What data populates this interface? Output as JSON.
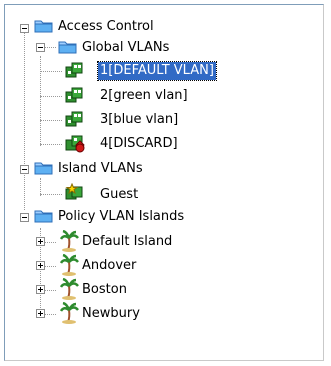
{
  "tree": {
    "access_control": {
      "label": "Access Control",
      "icon": "folder-icon"
    },
    "global_vlans": {
      "label": "Global VLANs",
      "icon": "folder-icon"
    },
    "vlans": [
      {
        "label": "1[DEFAULT VLAN]",
        "icon": "vlan-icon",
        "selected": true
      },
      {
        "label": "2[green vlan]",
        "icon": "vlan-icon"
      },
      {
        "label": "3[blue vlan]",
        "icon": "vlan-icon"
      },
      {
        "label": "4[DISCARD]",
        "icon": "vlan-discard-icon"
      }
    ],
    "island_vlans": {
      "label": "Island VLANs",
      "icon": "folder-icon"
    },
    "guest": {
      "label": "Guest",
      "icon": "vlan-star-icon"
    },
    "policy_vlan_islands": {
      "label": "Policy VLAN Islands",
      "icon": "folder-icon"
    },
    "islands": [
      {
        "label": "Default Island",
        "icon": "island-icon"
      },
      {
        "label": "Andover",
        "icon": "island-icon"
      },
      {
        "label": "Boston",
        "icon": "island-icon"
      },
      {
        "label": "Newbury",
        "icon": "island-icon"
      }
    ]
  },
  "colors": {
    "selection": "#316ac5",
    "folder": "#4aa0e8",
    "vlan_green": "#2f8f2f",
    "discard_red": "#d01818",
    "palm_trunk": "#a0522d",
    "palm_leaf": "#2e8b2e"
  }
}
